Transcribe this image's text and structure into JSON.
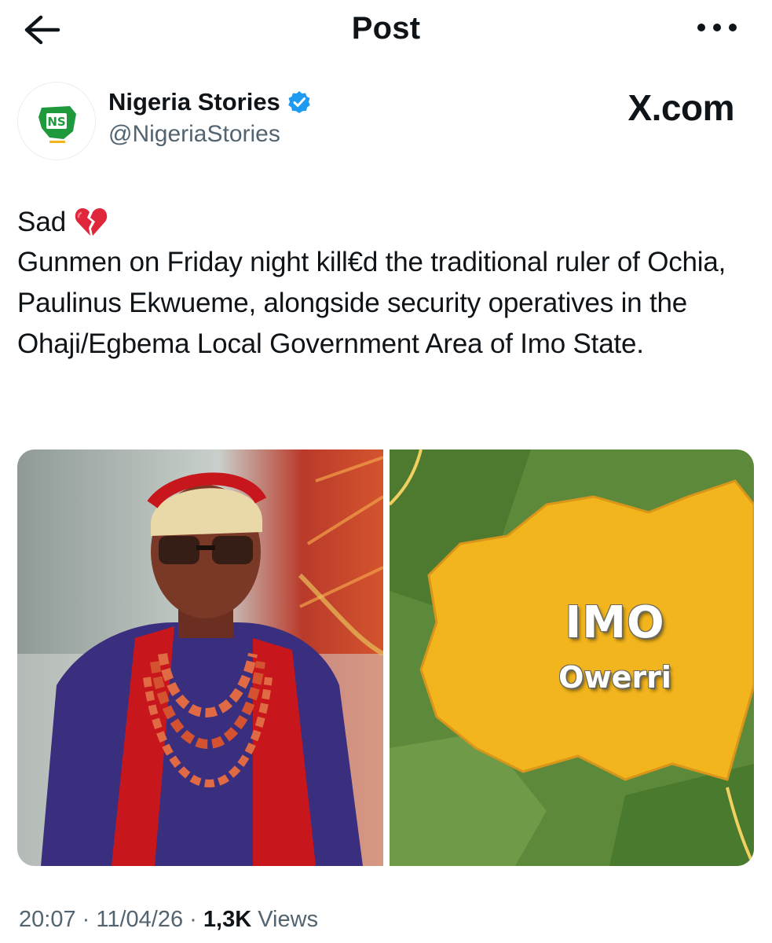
{
  "header": {
    "title": "Post",
    "back_icon": "arrow-left-icon",
    "more_icon": "more-horizontal-icon"
  },
  "author": {
    "name": "Nigeria Stories",
    "handle": "@NigeriaStories",
    "verified": true,
    "avatar_logo_text": "NS",
    "badge_color": "#1d9bf0"
  },
  "source_watermark": "X.com",
  "post": {
    "first_line": "Sad",
    "emoji_icon": "broken-heart-icon",
    "body": "Gunmen on Friday night kill€d the traditional ruler of Ochia, Paulinus Ekwueme, alongside security operatives in the Ohaji/Egbema Local Government Area of Imo State."
  },
  "media": {
    "map_state_label": "IMO",
    "map_capital_label": "Owerri"
  },
  "meta": {
    "time": "20:07",
    "separator": "·",
    "date": "11/04/26",
    "views_count": "1,3K",
    "views_label": "Views"
  },
  "colors": {
    "text_primary": "#0f1419",
    "text_secondary": "#536471",
    "verified_blue": "#1d9bf0",
    "map_region": "#f2b51d",
    "map_background": "#5d8a3a"
  }
}
